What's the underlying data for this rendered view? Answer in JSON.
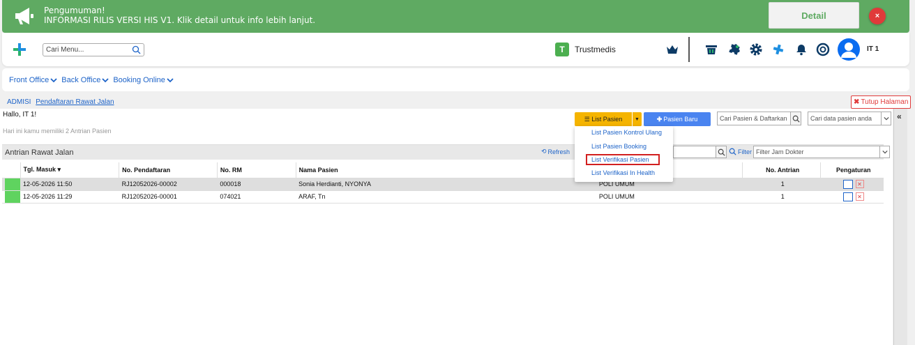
{
  "announcement": {
    "title": "Pengumuman!",
    "message": "INFORMASI RILIS VERSI HIS V1. Klik detail untuk info lebih lanjut.",
    "detail_label": "Detail",
    "close_label": "×"
  },
  "header": {
    "search_placeholder": "Cari Menu...",
    "brand_name": "Trustmedis",
    "user_name": "IT 1"
  },
  "nav": {
    "items": [
      {
        "label": "Front Office"
      },
      {
        "label": "Back Office"
      },
      {
        "label": "Booking Online"
      }
    ]
  },
  "breadcrumb": {
    "root": "ADMISI",
    "current": "Pendaftaran Rawat Jalan"
  },
  "close_page_label": "Tutup Halaman",
  "greeting": "Hallo, IT 1!",
  "queue_hint": "Hari ini kamu memiliki 2 Antrian Pasien",
  "toolbar": {
    "list_pasien_label": "List Pasien",
    "pasien_baru_label": "Pasien Baru",
    "search_register_placeholder": "Cari Pasien & Daftarkan",
    "search_data_placeholder": "Cari data pasien anda"
  },
  "dropdown": {
    "items": [
      {
        "label": "List Pasien Kontrol Ulang"
      },
      {
        "label": "List Pasien Booking"
      },
      {
        "label": "List Verifikasi Pasien"
      },
      {
        "label": "List Verifikasi In Health"
      }
    ]
  },
  "panel": {
    "title": "Antrian Rawat Jalan",
    "refresh_label": "Refresh",
    "filter_label": "Filter",
    "filter_placeholder": "Filter Jam Dokter"
  },
  "table": {
    "headers": [
      "",
      "Tgl. Masuk",
      "No. Pendaftaran",
      "No. RM",
      "Nama Pasien",
      "",
      "No. Antrian",
      "Pengaturan"
    ],
    "rows": [
      {
        "tgl": "12-05-2026 11:50",
        "no_daftar": "RJ12052026-00002",
        "no_rm": "000018",
        "nama": "Sonia Herdianti, NYONYA",
        "poli": "POLI UMUM",
        "antrian": "1"
      },
      {
        "tgl": "12-05-2026 11:29",
        "no_daftar": "RJ12052026-00001",
        "no_rm": "074021",
        "nama": "ARAF, Tn",
        "poli": "POLI UMUM",
        "antrian": "1"
      }
    ]
  },
  "colors": {
    "announce_bg": "#5faa62",
    "link": "#1d63c8",
    "primary_button": "#4a84f0",
    "warning_button": "#f5b400",
    "status_green": "#5fd35f",
    "highlight_red": "#d21f1f"
  }
}
